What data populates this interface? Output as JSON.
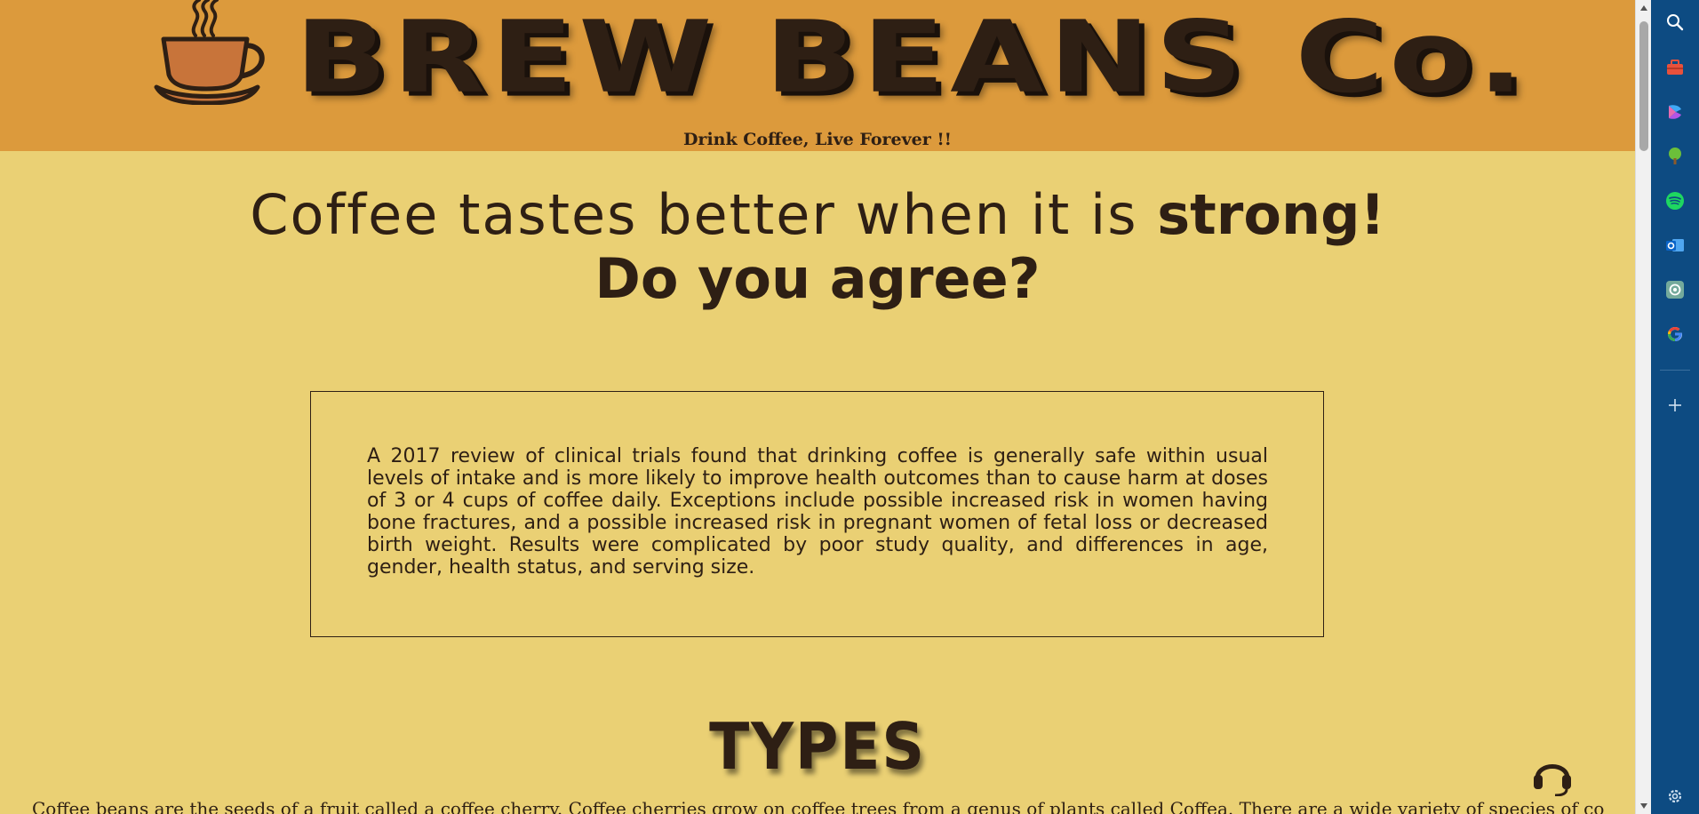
{
  "header": {
    "brand": "BREW BEANS Co.",
    "tagline": "Drink Coffee, Live Forever !!"
  },
  "headline": {
    "lead": "Coffee tastes better when it is ",
    "emphasis": "strong!",
    "line2": "Do you agree?"
  },
  "info_box": {
    "text": "A 2017 review of clinical trials found that drinking coffee is generally safe within usual levels of intake and is more likely to improve health outcomes than to cause harm at doses of 3 or 4 cups of coffee daily. Exceptions include possible increased risk in women having bone fractures, and a possible increased risk in pregnant women of fetal loss or decreased birth weight. Results were complicated by poor study quality, and differences in age, gender, health status, and serving size."
  },
  "types": {
    "title": "TYPES",
    "text": "Coffee beans are the seeds of a fruit called a coffee cherry. Coffee cherries grow on coffee trees from a genus of plants called Coffea. There are a wide variety of species of coffee"
  },
  "sidebar": {
    "icons": [
      "search-icon",
      "toolbox-icon",
      "copilot-icon",
      "tree-icon",
      "spotify-icon",
      "outlook-icon",
      "chatgpt-icon",
      "google-icon",
      "add-icon",
      "settings-icon"
    ]
  },
  "colors": {
    "header_bg": "#dc9a3c",
    "page_bg": "#ead074",
    "text_dark": "#2e1f14",
    "cup_orange": "#c8743a",
    "sidebar_bg": "#0d4b82"
  }
}
